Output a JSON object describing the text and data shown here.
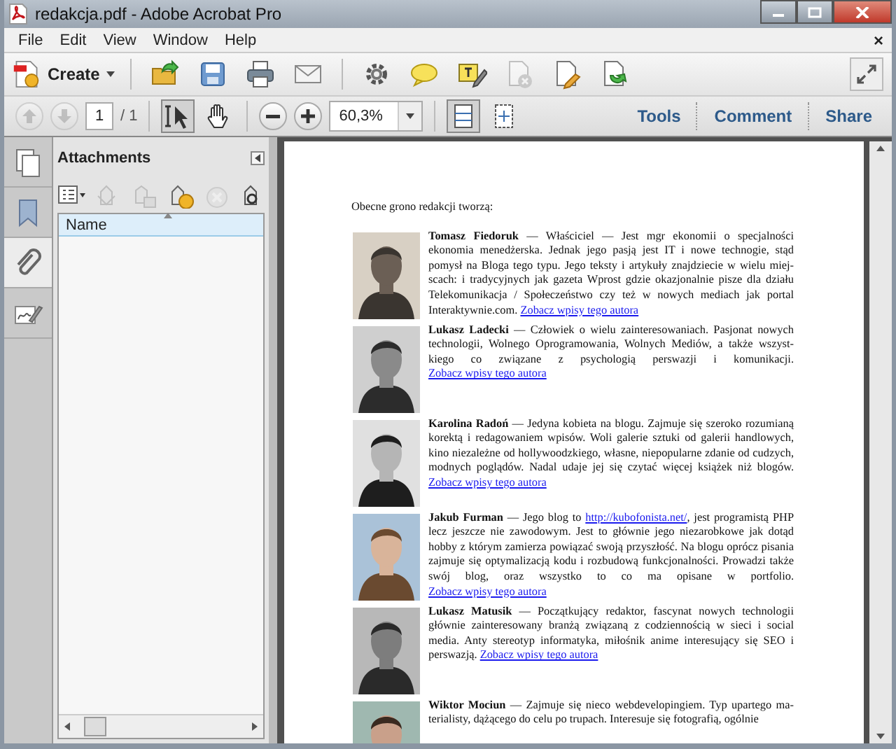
{
  "window": {
    "title": "redakcja.pdf - Adobe Acrobat Pro"
  },
  "menu": {
    "items": [
      {
        "label": "File"
      },
      {
        "label": "Edit"
      },
      {
        "label": "View"
      },
      {
        "label": "Window"
      },
      {
        "label": "Help"
      }
    ],
    "close": "×"
  },
  "toolbar": {
    "create": "Create",
    "tools": [
      {
        "kind": "open",
        "disabled": false
      },
      {
        "kind": "save",
        "disabled": false
      },
      {
        "kind": "print",
        "disabled": false
      },
      {
        "kind": "email",
        "disabled": false
      },
      {
        "kind": "settings",
        "disabled": false
      },
      {
        "kind": "comment",
        "disabled": false
      },
      {
        "kind": "textnote",
        "disabled": false
      },
      {
        "kind": "docremove",
        "disabled": true
      },
      {
        "kind": "docedit",
        "disabled": false
      },
      {
        "kind": "docexport",
        "disabled": false
      }
    ]
  },
  "navigation": {
    "prev_disabled": true,
    "next_disabled": true,
    "page": "1",
    "page_total": "/ 1",
    "modes": [
      {
        "kind": "select",
        "selected": true
      },
      {
        "kind": "hand",
        "selected": false
      }
    ],
    "zoom": "60,3%",
    "views": [
      {
        "kind": "fitpage",
        "selected": true
      },
      {
        "kind": "fitwidth",
        "selected": false
      }
    ],
    "panels": [
      {
        "label": "Tools"
      },
      {
        "label": "Comment"
      },
      {
        "label": "Share"
      }
    ]
  },
  "sidebar": {
    "tabs": [
      {
        "kind": "pages",
        "selected": false
      },
      {
        "kind": "bookmarks",
        "selected": false
      },
      {
        "kind": "attachments",
        "selected": true
      },
      {
        "kind": "signatures",
        "selected": false
      }
    ]
  },
  "attachments": {
    "title": "Attachments",
    "actions": [
      {
        "kind": "options",
        "disabled": false
      },
      {
        "kind": "open",
        "disabled": true
      },
      {
        "kind": "save",
        "disabled": true
      },
      {
        "kind": "add",
        "disabled": false
      },
      {
        "kind": "delete",
        "disabled": true
      },
      {
        "kind": "search",
        "disabled": false
      }
    ],
    "columns": [
      "Name"
    ]
  },
  "document": {
    "heading": "Obecne grono redakcji tworzą:",
    "authors": [
      {
        "name": "Tomasz Fiedoruk",
        "segments": [
          {
            "kind": "text",
            "text": " — Właściciel — Jest mgr ekonomii o specjalności ekonomia menedżerska. Jednak jego pasją jest IT i nowe technogie, stąd pomysł na Bloga tego typu. Jego teksty i artykuły znajdziecie w wielu miej-scach: i tradycyjnych jak gazeta Wprost gdzie okazjonalnie pisze dla działu Telekomunikacja / Społeczeństwo czy też w nowych mediach jak portal Interaktywnie.com. "
          },
          {
            "kind": "link",
            "text": "Zobacz wpisy tego autora"
          }
        ]
      },
      {
        "name": "Lukasz Ladecki",
        "segments": [
          {
            "kind": "text",
            "text": " — Człowiek o wielu zainteresowaniach. Pasjonat nowych technologii, Wolnego Oprogramowania, Wolnych Mediów, a także wszyst-kiego co związane z psychologią perswazji i komunikacji. "
          },
          {
            "kind": "link",
            "text": "Zobacz wpisy tego autora"
          }
        ]
      },
      {
        "name": "Karolina Radoń",
        "segments": [
          {
            "kind": "text",
            "text": " — Jedyna kobieta na blogu. Zajmuje się szeroko rozumianą korektą i redagowaniem wpisów. Woli galerie sztuki od galerii handlowych, kino niezależne od hollywoodzkiego, własne, niepopularne zdanie od cudzych, modnych poglądów. Nadal udaje jej się czytać więcej książek niż blogów. "
          },
          {
            "kind": "link",
            "text": "Zobacz wpisy tego autora"
          }
        ]
      },
      {
        "name": "Jakub Furman",
        "segments": [
          {
            "kind": "text",
            "text": " — Jego blog to "
          },
          {
            "kind": "link",
            "text": "http://kubofonista.net/"
          },
          {
            "kind": "text",
            "text": ", jest programistą PHP lecz jeszcze nie zawodowym. Jest to głównie jego niezarobkowe jak dotąd hobby z którym zamierza powiązać swoją przyszłość. Na blogu oprócz pisania zajmuje się optymalizacją kodu i rozbudową funkcjonalności. Prowadzi także swój blog, oraz wszystko to co ma opisane w portfolio. "
          },
          {
            "kind": "link",
            "text": "Zobacz wpisy tego autora"
          }
        ]
      },
      {
        "name": "Lukasz Matusik",
        "segments": [
          {
            "kind": "text",
            "text": " — Początkujący redaktor, fascynat nowych technologii głównie zainteresowany branżą związaną z codziennością w sieci i social media. Anty stereotyp informatyka, miłośnik anime interesujący się SEO i perswazją. "
          },
          {
            "kind": "link",
            "text": "Zobacz wpisy tego autora"
          }
        ]
      },
      {
        "name": "Wiktor Mociun",
        "segments": [
          {
            "kind": "text",
            "text": " — Zajmuje się nieco webdevelopingiem. Typ upartego ma-terialisty, dążącego do celu po trupach. Interesuje się fotografią, ogólnie"
          }
        ]
      }
    ]
  }
}
